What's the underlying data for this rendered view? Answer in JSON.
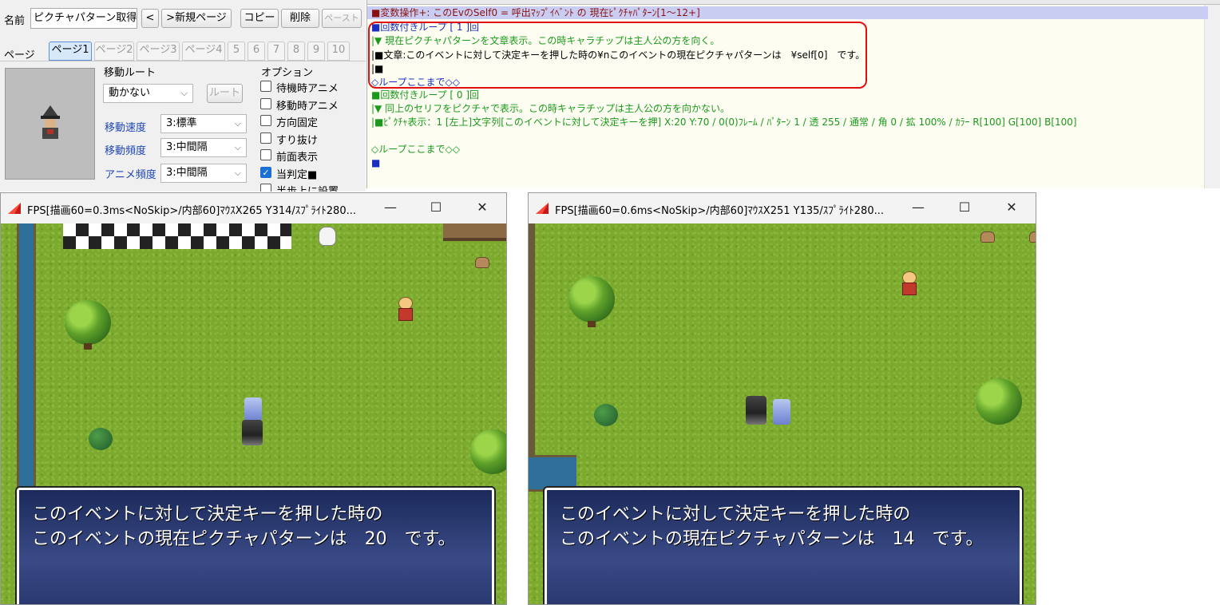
{
  "editor": {
    "name_label": "名前",
    "name_value": "ピクチャパターン取得",
    "prev_button": "<",
    "new_page_button": ">新規ページ",
    "copy_button": "コピー",
    "delete_button": "削除",
    "paste_button": "ペースト",
    "page_label": "ページ",
    "page_tabs": [
      "ページ1",
      "ページ2",
      "ページ3",
      "ページ4",
      "5",
      "6",
      "7",
      "8",
      "9",
      "10"
    ],
    "move_route": {
      "header": "移動ルート",
      "type_value": "動かない",
      "route_button": "ルート",
      "speed_label": "移動速度",
      "speed_value": "3:標準",
      "freq_label": "移動頻度",
      "freq_value": "3:中間隔",
      "anim_label": "アニメ頻度",
      "anim_value": "3:中間隔"
    },
    "options": {
      "header": "オプション",
      "items": [
        {
          "label": "待機時アニメ",
          "checked": false
        },
        {
          "label": "移動時アニメ",
          "checked": false
        },
        {
          "label": "方向固定",
          "checked": false
        },
        {
          "label": "すり抜け",
          "checked": false
        },
        {
          "label": "前面表示",
          "checked": false
        },
        {
          "label": "当判定■",
          "checked": true
        },
        {
          "label": "半歩上に設置",
          "checked": false
        }
      ]
    }
  },
  "event_list": {
    "lines": [
      {
        "text": "■変数操作+: このEvのSelf0 = 呼出ﾏｯﾌﾟｲﾍﾞﾝﾄ の 現在ﾋﾟｸﾁｬﾊﾟﾀｰﾝ[1～12+]",
        "color": "#8a1010"
      },
      {
        "text": "■回数付きループ [ 1 ]回",
        "color": "#1a2fbf"
      },
      {
        "text": "|▼ 現在ピクチャパターンを文章表示。この時キャラチップは主人公の方を向く。",
        "color": "#1a9a1a"
      },
      {
        "text": "|■文章:このイベントに対して決定キーを押した時の¥nこのイベントの現在ピクチャパターンは　¥self[0]　です。",
        "color": "#000000"
      },
      {
        "text": "|■",
        "color": "#000000"
      },
      {
        "text": "◇ループここまで◇◇",
        "color": "#1a2fbf"
      },
      {
        "text": "■回数付きループ [ 0 ]回",
        "color": "#1a9a1a"
      },
      {
        "text": "|▼ 同上のセリフをピクチャで表示。この時キャラチップは主人公の方を向かない。",
        "color": "#1a9a1a"
      },
      {
        "text": "|■ﾋﾟｸﾁｬ表示：1 [左上]文字列[このイベントに対して決定キーを押] X:20 Y:70 / 0(0)ﾌﾚｰﾑ / ﾊﾟﾀｰﾝ 1 / 透 255 / 通常 / 角 0 / 拡 100% / ｶﾗｰ R[100] G[100] B[100]",
        "color": "#1a9a1a"
      },
      {
        "text": "◇ループここまで◇◇",
        "color": "#1a9a1a"
      },
      {
        "text": "■",
        "color": "#1a2fbf"
      }
    ]
  },
  "game_windows": [
    {
      "title": "FPS[描画60=0.3ms<NoSkip>/内部60]ﾏｳｽX265 Y314/ｽﾌﾟﾗｲﾄ280...",
      "message_line1": "このイベントに対して決定キーを押した時の",
      "message_line2": "このイベントの現在ピクチャパターンは　20　です。"
    },
    {
      "title": "FPS[描画60=0.6ms<NoSkip>/内部60]ﾏｳｽX251 Y135/ｽﾌﾟﾗｲﾄ280...",
      "message_line1": "このイベントに対して決定キーを押した時の",
      "message_line2": "このイベントの現在ピクチャパターンは　14　です。"
    }
  ],
  "window_controls": {
    "minimize": "—",
    "maximize": "☐",
    "close": "✕"
  },
  "colors": {
    "accent_red_box": "#e01010",
    "selected_row": "#c9cdf2",
    "message_bg": "#2a3870"
  }
}
